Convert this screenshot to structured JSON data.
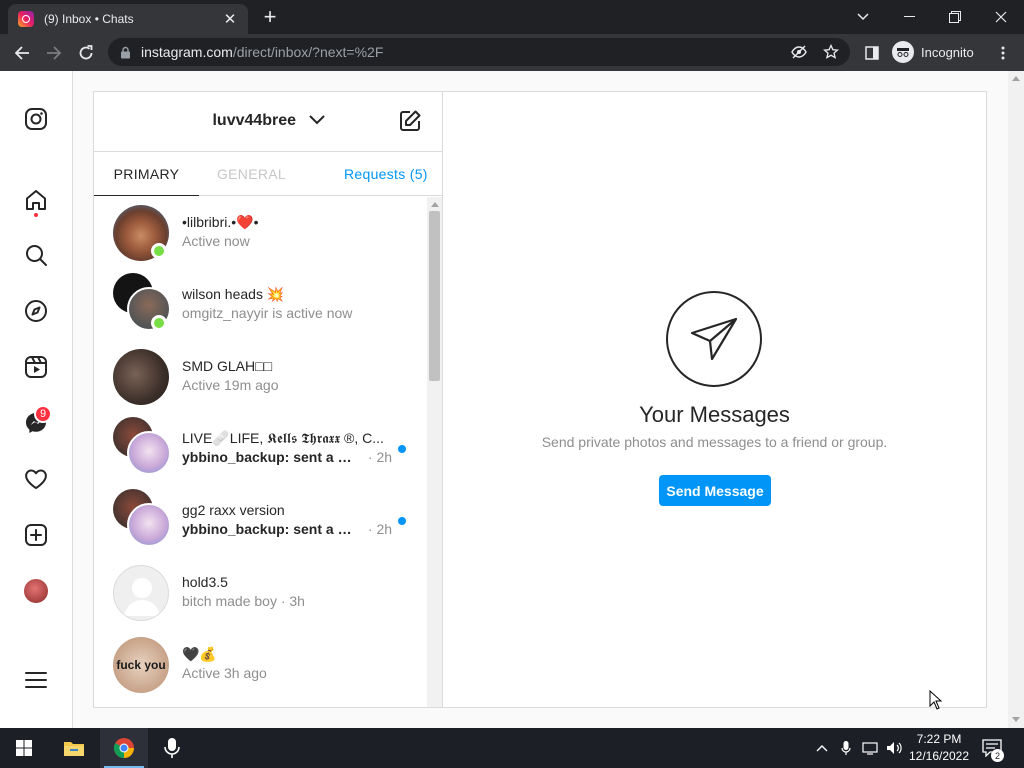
{
  "browser": {
    "tab_title": "(9) Inbox • Chats",
    "url_domain": "instagram.com",
    "url_path": "/direct/inbox/?next=%2F",
    "profile_label": "Incognito"
  },
  "leftnav": {
    "messages_badge": "9"
  },
  "inbox": {
    "username": "luvv44bree",
    "tabs": {
      "primary": "PRIMARY",
      "general": "GENERAL",
      "requests": "Requests (5)"
    },
    "threads": [
      {
        "name": "•lilbribri.•❤️•",
        "sub": "Active now",
        "unread": false,
        "online": true,
        "avatar_color": "#b57a5a"
      },
      {
        "name": "wilson heads 💥",
        "sub": "omgitz_nayyir is active now",
        "unread": false,
        "online": true,
        "avatar_color": "#1a1a1a"
      },
      {
        "name": "SMD GLAH□□",
        "sub": "Active 19m ago",
        "unread": false,
        "online": false,
        "avatar_color": "#4a3b33"
      },
      {
        "name": "LIVE🩹LIFE, 𝕶𝖊𝖑𝖑𝖘 𝕿𝖍𝖗𝖆𝖝𝖝 ®, C...",
        "preview": "ybbino_backup: sent a mes...",
        "time": " · 2h",
        "unread": true,
        "online": false,
        "avatar_color": "#5a4c6e"
      },
      {
        "name": "gg2 raxx version",
        "preview": "ybbino_backup: sent a mes...",
        "time": " · 2h",
        "unread": true,
        "online": false,
        "avatar_color": "#6a5a7e"
      },
      {
        "name": "hold3.5",
        "sub": "bitch made boy · 3h",
        "unread": false,
        "online": false,
        "avatar_color": "#e0e0e0"
      },
      {
        "name": "🖤💰",
        "sub": "Active 3h ago",
        "unread": false,
        "online": false,
        "avatar_color": "#c9a58a",
        "avatar_text": "fuck you"
      }
    ]
  },
  "empty_state": {
    "title": "Your Messages",
    "subtitle": "Send private photos and messages to a friend or group.",
    "button": "Send Message"
  },
  "taskbar": {
    "time": "7:22 PM",
    "date": "12/16/2022",
    "notification_count": "2"
  }
}
